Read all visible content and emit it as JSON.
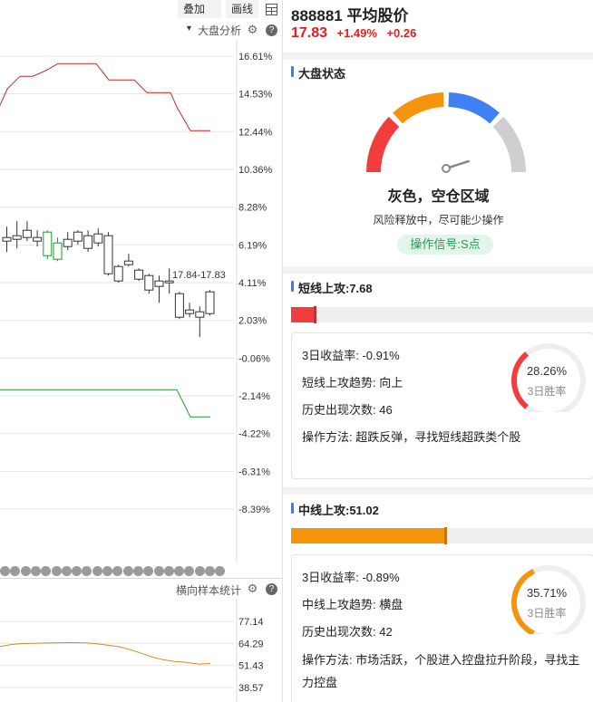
{
  "toolbar": {
    "overlay_label": "叠加",
    "overlay_caret": "▾",
    "draw_label": "画线",
    "grid_icon": "grid-icon"
  },
  "main_panel": {
    "title": "大盘分析",
    "y_ticks": [
      "16.61%",
      "14.53%",
      "12.44%",
      "10.36%",
      "8.28%",
      "6.19%",
      "4.11%",
      "2.03%",
      "-0.06%",
      "-2.14%",
      "-4.22%",
      "-6.31%",
      "-8.39%"
    ],
    "range_label": "17.84-17.83",
    "colors": {
      "up": "#e02020",
      "down": "#1a9a2a",
      "grid": "#e6e6e6",
      "text": "#333333"
    }
  },
  "chart_data": {
    "type": "line",
    "y_unit": "%",
    "ylim": [
      -8.39,
      16.61
    ],
    "series": [
      {
        "color": "#cc2222",
        "values": [
          13.9,
          14.8,
          15.5,
          15.5,
          15.8,
          16.2,
          16.2,
          16.2,
          16.2,
          15.3,
          15.3,
          15.3,
          14.6,
          14.6,
          14.6,
          13.8,
          12.5,
          12.5,
          12.5,
          12.5
        ]
      },
      {
        "color": "#1a9a2a",
        "values": [
          -1.8,
          -1.8,
          -1.8,
          -1.8,
          -1.8,
          -1.8,
          -1.8,
          -1.8,
          -1.8,
          -1.8,
          -1.8,
          -1.8,
          -1.8,
          -1.8,
          -1.8,
          -1.8,
          -3.3,
          -3.3,
          -3.3,
          -3.3
        ]
      }
    ],
    "candles": [
      {
        "o": 6.6,
        "c": 6.4,
        "h": 7.2,
        "l": 5.8
      },
      {
        "o": 6.5,
        "c": 6.7,
        "h": 7.5,
        "l": 6.0
      },
      {
        "o": 6.6,
        "c": 7.0,
        "h": 7.5,
        "l": 6.4
      },
      {
        "o": 6.4,
        "c": 6.6,
        "h": 7.0,
        "l": 6.1
      },
      {
        "o": 6.9,
        "c": 5.6,
        "h": 7.0,
        "l": 5.4
      },
      {
        "o": 6.3,
        "c": 5.4,
        "h": 6.6,
        "l": 5.3
      },
      {
        "o": 6.1,
        "c": 6.5,
        "h": 6.9,
        "l": 5.9
      },
      {
        "o": 6.4,
        "c": 6.9,
        "h": 7.0,
        "l": 6.2
      },
      {
        "o": 6.7,
        "c": 6.0,
        "h": 7.0,
        "l": 5.8
      },
      {
        "o": 6.3,
        "c": 6.8,
        "h": 7.1,
        "l": 6.1
      },
      {
        "o": 6.7,
        "c": 4.6,
        "h": 6.9,
        "l": 4.5
      },
      {
        "o": 5.0,
        "c": 4.2,
        "h": 5.1,
        "l": 4.1
      },
      {
        "o": 5.1,
        "c": 5.3,
        "h": 5.7,
        "l": 5.0
      },
      {
        "o": 4.8,
        "c": 4.3,
        "h": 4.9,
        "l": 4.2
      },
      {
        "o": 4.5,
        "c": 3.7,
        "h": 4.6,
        "l": 3.5
      },
      {
        "o": 4.2,
        "c": 3.9,
        "h": 4.5,
        "l": 3.0
      },
      {
        "o": 4.1,
        "c": 4.2,
        "h": 4.9,
        "l": 3.5
      },
      {
        "o": 3.5,
        "c": 2.2,
        "h": 3.6,
        "l": 2.1
      },
      {
        "o": 2.6,
        "c": 2.4,
        "h": 3.0,
        "l": 2.2
      },
      {
        "o": 2.5,
        "c": 2.2,
        "h": 2.8,
        "l": 1.1
      },
      {
        "o": 2.4,
        "c": 3.6,
        "h": 3.7,
        "l": 2.3
      }
    ]
  },
  "sub_panel": {
    "title": "横向样本统计",
    "y_ticks": [
      "77.14",
      "64.29",
      "51.43",
      "38.57"
    ],
    "ylim": [
      38.57,
      77.14
    ],
    "line_color": "#d98a1a",
    "values": [
      62.5,
      63.6,
      64.2,
      64.3,
      64.5,
      64.6,
      64.7,
      64.7,
      64.6,
      64.0,
      63.2,
      62.3,
      60.6,
      58.5,
      56.3,
      54.8,
      53.8,
      53.3,
      52.2,
      52.6
    ]
  },
  "stock": {
    "name": "888881 平均股价",
    "price": "17.83",
    "pct": "+1.49%",
    "change": "+0.26"
  },
  "market": {
    "header": "大盘状态",
    "gauge_colors": [
      "#f23d3d",
      "#f5930d",
      "#3f80f5",
      "#cfcfcf"
    ],
    "gauge_level": 0.9,
    "state": "灰色，空仓区域",
    "advice": "风险释放中，尽可能少操作",
    "signal": "操作信号:S点"
  },
  "short_attack": {
    "header": "短线上攻:7.68",
    "level": 0.0768,
    "color": "#f23d3d",
    "return_3d": "3日收益率: -0.91%",
    "trend": "短线上攻趋势: 向上",
    "count": "历史出现次数: 46",
    "method": "操作方法: 超跌反弹，寻找短线超跌类个股",
    "win_rate": 0.2826,
    "win_pct": "28.26%",
    "win_label": "3日胜率"
  },
  "mid_attack": {
    "header": "中线上攻:51.02",
    "level": 0.5102,
    "color": "#f5930d",
    "return_3d": "3日收益率: -0.89%",
    "trend": "中线上攻趋势: 横盘",
    "count": "历史出现次数: 42",
    "method": "操作方法: 市场活跃，个股进入控盘拉升阶段，寻找主力控盘",
    "win_rate": 0.3571,
    "win_pct": "35.71%",
    "win_label": "3日胜率"
  }
}
